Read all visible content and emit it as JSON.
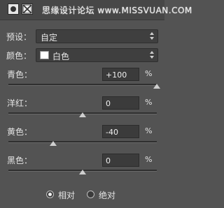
{
  "header": {
    "watermark": "思缘设计论坛 www.MISSVUAN.COM",
    "icons": [
      "layer-mask-icon",
      "adjustment-icon"
    ]
  },
  "preset": {
    "label": "预设：",
    "value": "自定"
  },
  "colors": {
    "label": "颜色：",
    "value": "白色",
    "swatch": "#ffffff"
  },
  "sliders": [
    {
      "label": "青色：",
      "value": "+100",
      "unit": "%",
      "fraction": 1.0
    },
    {
      "label": "洋红：",
      "value": "0",
      "unit": "%",
      "fraction": 0.5
    },
    {
      "label": "黄色：",
      "value": "-40",
      "unit": "%",
      "fraction": 0.3
    },
    {
      "label": "黑色：",
      "value": "0",
      "unit": "%",
      "fraction": 0.5
    }
  ],
  "mode": {
    "relative": "相对",
    "absolute": "绝对",
    "selected": "relative"
  }
}
